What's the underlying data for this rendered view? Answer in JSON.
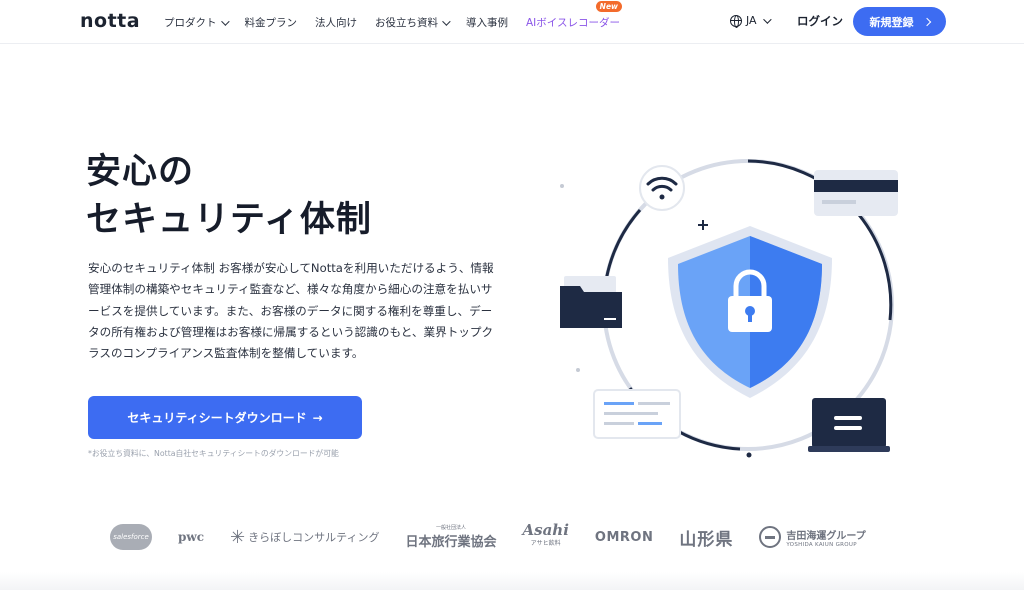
{
  "header": {
    "logo": "notta",
    "nav": [
      {
        "label": "プロダクト",
        "dropdown": true
      },
      {
        "label": "料金プラン",
        "dropdown": false
      },
      {
        "label": "法人向け",
        "dropdown": false
      },
      {
        "label": "お役立ち資料",
        "dropdown": true
      },
      {
        "label": "導入事例",
        "dropdown": false
      }
    ],
    "ai_item": {
      "label": "AIボイスレコーダー",
      "badge": "New"
    },
    "language": "JA",
    "login_label": "ログイン",
    "signup_label": "新規登録"
  },
  "hero": {
    "title_line1": "安心の",
    "title_line2": "セキュリティ体制",
    "description": "安心のセキュリティ体制 お客様が安心してNottaを利用いただけるよう、情報管理体制の構築やセキュリティ監査など、様々な角度から細心の注意を払いサービスを提供しています。また、お客様のデータに関する権利を尊重し、データの所有権および管理権はお客様に帰属するという認識のもと、業界トップクラスのコンプライアンス監査体制を整備しています。",
    "cta_label": "セキュリティシートダウンロード",
    "cta_arrow": "→",
    "footnote": "*お役立ち資料に、Notta自社セキュリティシートのダウンロードが可能"
  },
  "partners": {
    "salesforce": "salesforce",
    "pwc": "pwc",
    "kiraboshi": "きらぼしコンサルティング",
    "jata_small": "一般社団法人",
    "jata": "日本旅行業協会",
    "asahi": "Asahi",
    "asahi_sub": "アサヒ飲料",
    "omron": "OMRON",
    "yamagata": "山形県",
    "yoshida": "吉田海運グループ",
    "yoshida_sub": "YOSHIDA KAIUN GROUP"
  },
  "colors": {
    "primary": "#3d6cf2",
    "ai_accent": "#8a55e8",
    "badge": "#f36b2c",
    "navy": "#1e2a44"
  },
  "icons": [
    "wifi-icon",
    "credit-card-icon",
    "folder-icon",
    "shield-lock-icon",
    "document-icon",
    "laptop-icon",
    "globe-icon"
  ]
}
